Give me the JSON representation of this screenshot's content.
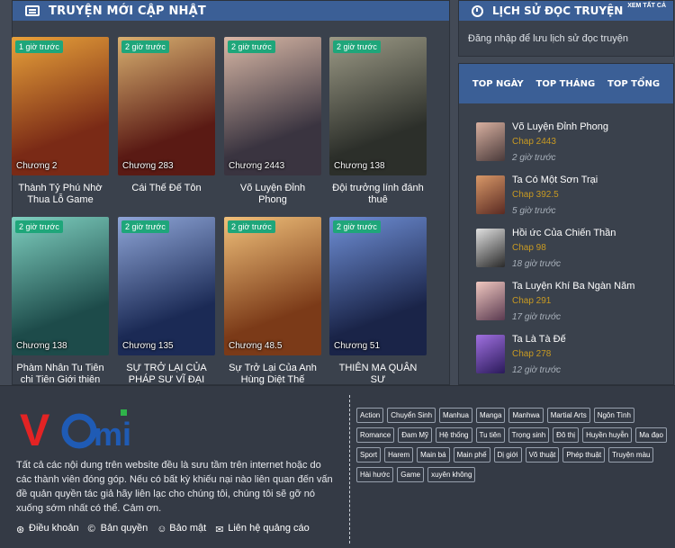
{
  "left": {
    "title": "TRUYỆN MỚI CẬP NHẬT",
    "cards": [
      {
        "name": "Thành Tỷ Phú Nhờ Thua Lỗ Game",
        "chapter": "Chương 2",
        "time": "1 giờ trước",
        "colors": [
          "#7a2a16",
          "#e8a23a"
        ]
      },
      {
        "name": "Cái Thế Đế Tôn",
        "chapter": "Chương 283",
        "time": "2 giờ trước",
        "colors": [
          "#5a1a14",
          "#d8b070"
        ]
      },
      {
        "name": "Võ Luyện Đỉnh Phong",
        "chapter": "Chương 2443",
        "time": "2 giờ trước",
        "colors": [
          "#3a3440",
          "#d9b8a6"
        ]
      },
      {
        "name": "Đội trưởng lính đánh thuê",
        "chapter": "Chương 138",
        "time": "2 giờ trước",
        "colors": [
          "#2c2f2a",
          "#9c9a86"
        ]
      },
      {
        "name": "Phàm Nhân Tu Tiên chi Tiên Giới thiên",
        "chapter": "Chương 138",
        "time": "2 giờ trước",
        "colors": [
          "#1d4b4a",
          "#7fd0c0"
        ]
      },
      {
        "name": "SỰ TRỞ LẠI CỦA PHÁP SƯ VĨ ĐẠI SAU",
        "chapter": "Chương 135",
        "time": "2 giờ trước",
        "colors": [
          "#1b2a55",
          "#8fa6d8"
        ]
      },
      {
        "name": "Sự Trở Lại Của Anh Hùng Diệt Thế",
        "chapter": "Chương 48.5",
        "time": "2 giờ trước",
        "colors": [
          "#7b3a18",
          "#f0c07a"
        ]
      },
      {
        "name": "THIÊN MA QUÂN SƯ",
        "chapter": "Chương 51",
        "time": "2 giờ trước",
        "colors": [
          "#1a2448",
          "#6f8fd6"
        ]
      }
    ]
  },
  "history": {
    "title": "LỊCH SỬ ĐỌC TRUYỆN",
    "see_all": "XEM TẤT CẢ",
    "message": "Đăng nhập để lưu lịch sử đọc truyện"
  },
  "top": {
    "tabs": [
      "TOP NGÀY",
      "TOP THÁNG",
      "TOP TỔNG"
    ],
    "items": [
      {
        "title": "Võ Luyện Đỉnh Phong",
        "chapter": "Chap 2443",
        "time": "2 giờ trước",
        "colors": [
          "#4a3a3a",
          "#d8b0a0"
        ]
      },
      {
        "title": "Ta Có Một Sơn Trại",
        "chapter": "Chap 392.5",
        "time": "5 giờ trước",
        "colors": [
          "#5a2a22",
          "#d89868"
        ]
      },
      {
        "title": "Hồi ức Của Chiến Thần",
        "chapter": "Chap 98",
        "time": "18 giờ trước",
        "colors": [
          "#2a2a2a",
          "#e0e0e0"
        ]
      },
      {
        "title": "Ta Luyện Khí Ba Ngàn Năm",
        "chapter": "Chap 291",
        "time": "17 giờ trước",
        "colors": [
          "#5a3a50",
          "#f0c8c0"
        ]
      },
      {
        "title": "Ta Là Tà Đế",
        "chapter": "Chap 278",
        "time": "12 giờ trước",
        "colors": [
          "#2a1a5a",
          "#a070e0"
        ]
      }
    ]
  },
  "footer": {
    "disclaimer": "Tất cả các nội dung trên website đều là sưu tầm trên internet hoặc do các thành viên đóng góp. Nếu có bất kỳ khiếu nại nào liên quan đến vấn đề quản quyền tác giả hãy liên lạc cho chúng tôi, chúng tôi sẽ gỡ nó xuống sớm nhất có thể. Cảm ơn.",
    "links": [
      "Điều khoản",
      "Bản quyền",
      "Bảo mật",
      "Liên hệ quảng cáo"
    ],
    "tags": [
      "Action",
      "Chuyển Sinh",
      "Manhua",
      "Manga",
      "Manhwa",
      "Martial Arts",
      "Ngôn Tình",
      "Romance",
      "Đam Mỹ",
      "Hệ thống",
      "Tu tiên",
      "Trọng sinh",
      "Đô thị",
      "Huyền huyễn",
      "Ma đạo",
      "Sport",
      "Harem",
      "Main bá",
      "Main phế",
      "Dị giới",
      "Võ thuật",
      "Phép thuật",
      "Truyện màu",
      "Hài hước",
      "Game",
      "xuyên không"
    ]
  },
  "logo": {
    "text_v": "V",
    "text_c": "C",
    "text_mi": "mi",
    "colors": {
      "red": "#e32324",
      "blue": "#1f5bb5",
      "green": "#2fb34a"
    }
  }
}
